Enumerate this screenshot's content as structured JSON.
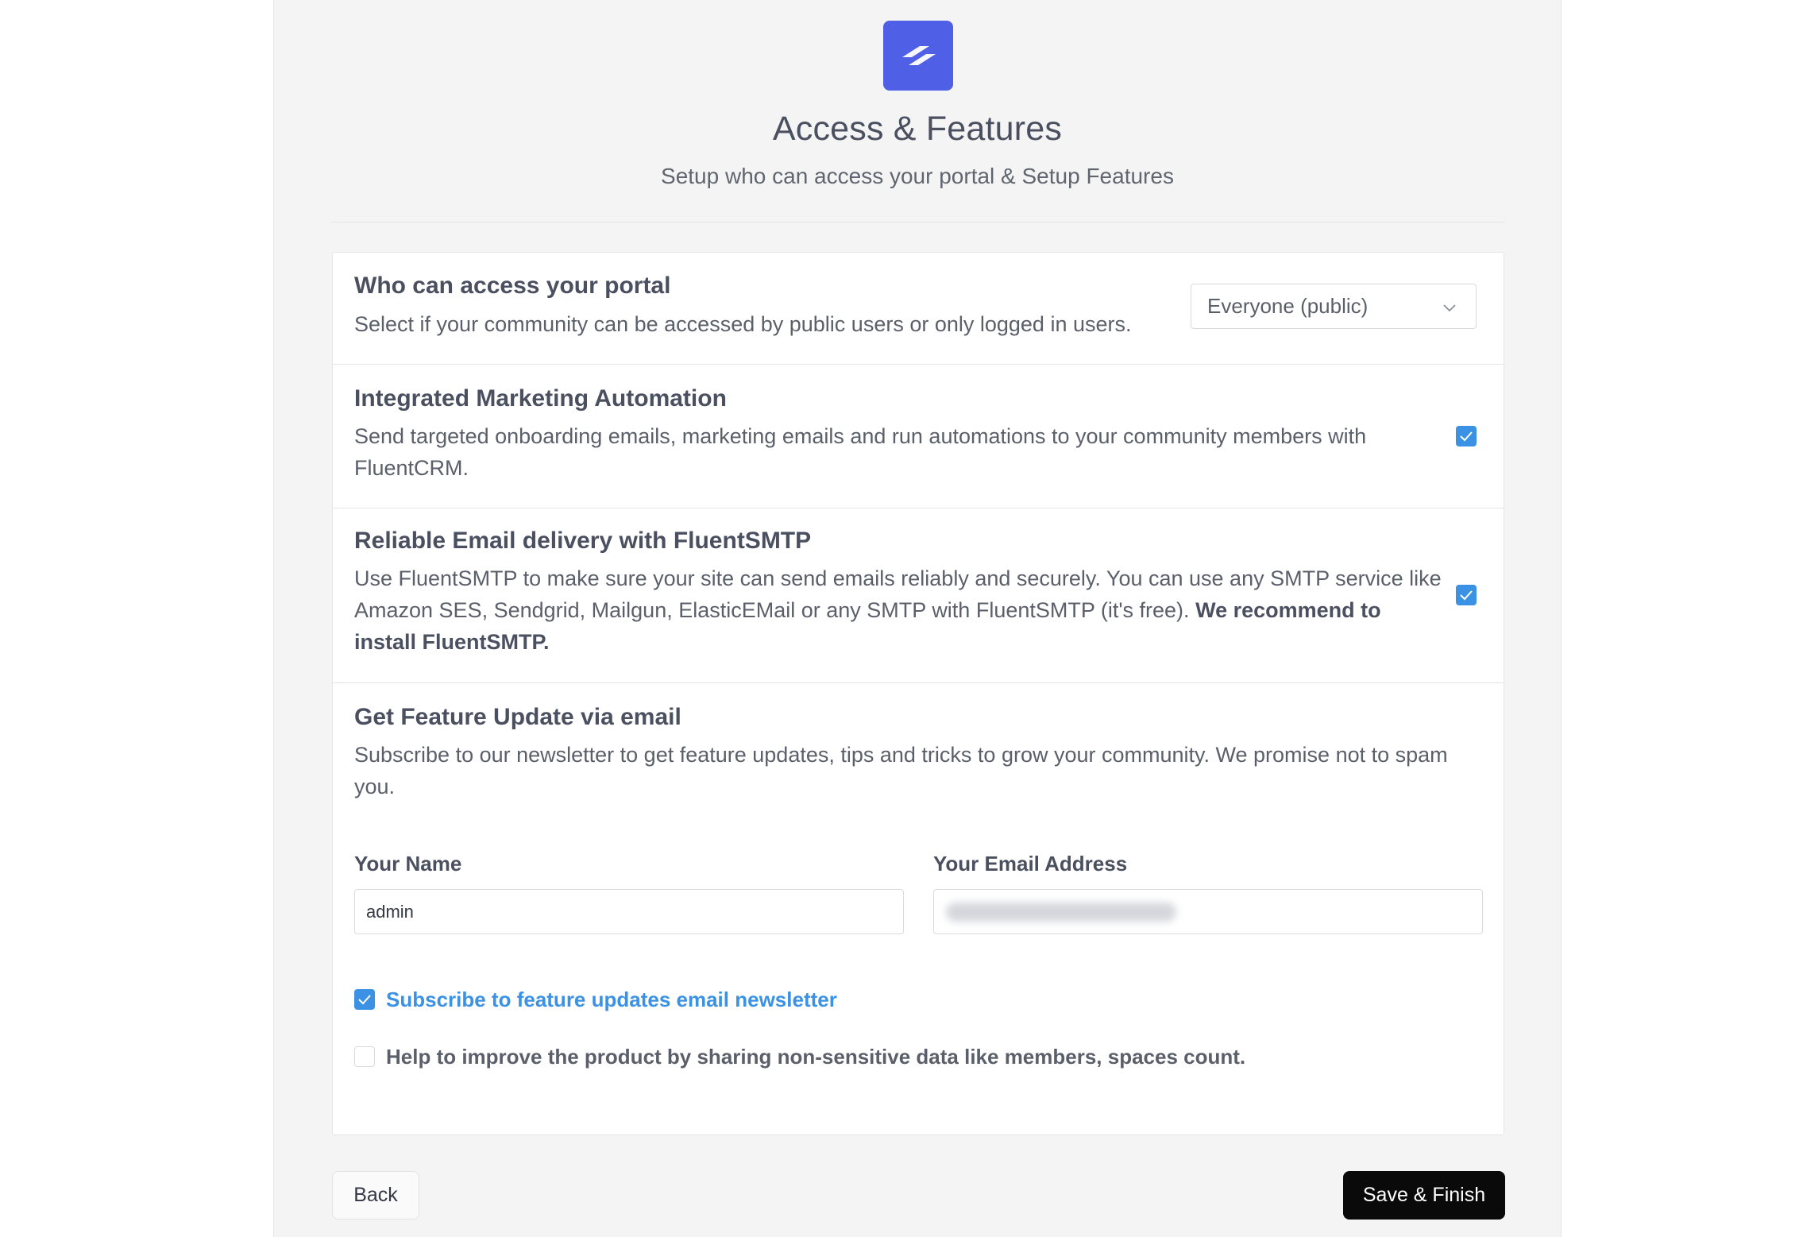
{
  "header": {
    "title": "Access & Features",
    "subtitle": "Setup who can access your portal & Setup Features",
    "logo_icon": "fluent-community-logo-icon",
    "brand_color": "#4f5fe6"
  },
  "access": {
    "title": "Who can access your portal",
    "description": "Select if your community can be accessed by public users or only logged in users.",
    "selected": "Everyone (public)"
  },
  "marketing": {
    "title": "Integrated Marketing Automation",
    "description": "Send targeted onboarding emails, marketing emails and run automations to your community members with FluentCRM.",
    "checked": true
  },
  "smtp": {
    "title": "Reliable Email delivery with FluentSMTP",
    "description": "Use FluentSMTP to make sure your site can send emails reliably and securely. You can use any SMTP service like Amazon SES, Sendgrid, Mailgun, ElasticEMail or any SMTP with FluentSMTP (it's free).",
    "description_bold": "We recommend to install FluentSMTP.",
    "checked": true
  },
  "updates": {
    "title": "Get Feature Update via email",
    "description": "Subscribe to our newsletter to get feature updates, tips and tricks to grow your community. We promise not to spam you.",
    "name_label": "Your Name",
    "name_value": "admin",
    "email_label": "Your Email Address",
    "subscribe_label": "Subscribe to feature updates email newsletter",
    "subscribe_checked": true,
    "share_label": "Help to improve the product by sharing non-sensitive data like members, spaces count.",
    "share_checked": false
  },
  "footer": {
    "back_label": "Back",
    "save_label": "Save & Finish"
  },
  "colors": {
    "accent": "#3b92e4",
    "primary_button": "#0a0a0a"
  }
}
